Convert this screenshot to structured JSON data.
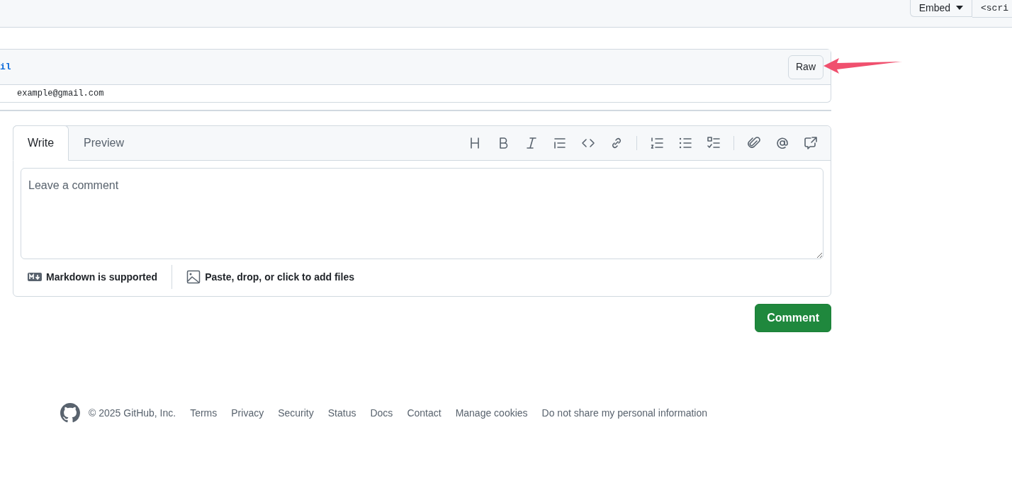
{
  "top_bar": {
    "embed_button": "Embed",
    "embed_code": "<scri"
  },
  "file": {
    "name": "il",
    "raw_button": "Raw",
    "lines": [
      "example@gmail.com"
    ]
  },
  "comment_form": {
    "tabs": [
      {
        "label": "Write",
        "selected": true
      },
      {
        "label": "Preview",
        "selected": false
      }
    ],
    "placeholder": "Leave a comment",
    "markdown_note": "Markdown is supported",
    "attach_note": "Paste, drop, or click to add files",
    "submit_button": "Comment"
  },
  "footer": {
    "copyright": "© 2025 GitHub, Inc.",
    "links": [
      "Terms",
      "Privacy",
      "Security",
      "Status",
      "Docs",
      "Contact",
      "Manage cookies",
      "Do not share my personal information"
    ]
  }
}
